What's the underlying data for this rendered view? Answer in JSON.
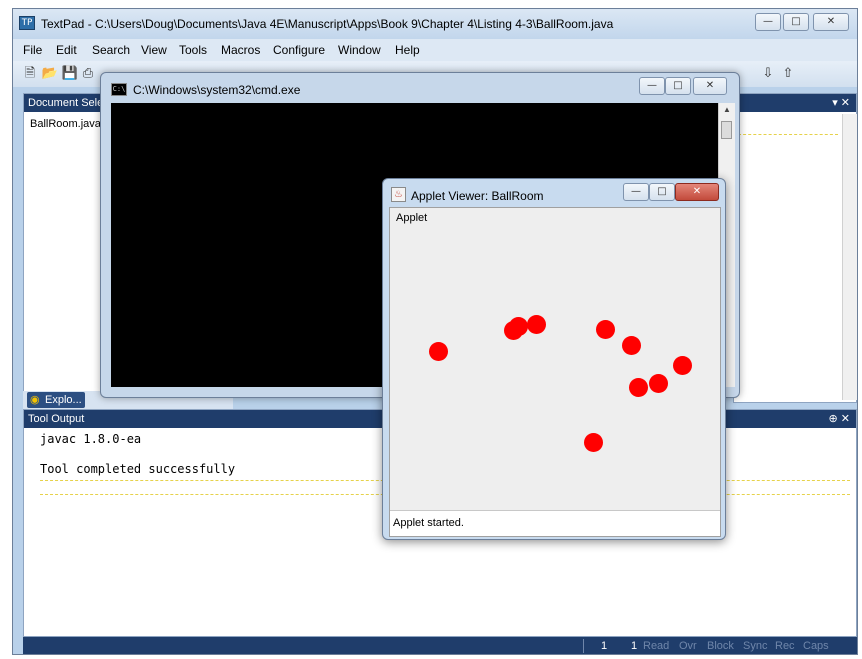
{
  "textpad": {
    "title": "TextPad - C:\\Users\\Doug\\Documents\\Java 4E\\Manuscript\\Apps\\Book 9\\Chapter 4\\Listing 4-3\\BallRoom.java",
    "menu": [
      "File",
      "Edit",
      "Search",
      "View",
      "Tools",
      "Macros",
      "Configure",
      "Window",
      "Help"
    ],
    "doc_selector": {
      "title": "Document Sele",
      "file": "BallRoom.java"
    },
    "explorer_tab": "Explo...",
    "tool_output": {
      "title": "Tool Output",
      "lines": [
        "javac 1.8.0-ea",
        "",
        "Tool completed successfully"
      ]
    },
    "statusbar": {
      "line": "1",
      "col": "1",
      "indicators": [
        "Read",
        "Ovr",
        "Block",
        "Sync",
        "Rec",
        "Caps"
      ]
    }
  },
  "cmd": {
    "title": "C:\\Windows\\system32\\cmd.exe"
  },
  "applet": {
    "title": "Applet Viewer: BallRoom",
    "menu_label": "Applet",
    "status": "Applet started.",
    "ball_color": "#ff0000"
  },
  "colors": {
    "panel_header": "#1f3d6b",
    "frame": "#b9d1ea"
  }
}
